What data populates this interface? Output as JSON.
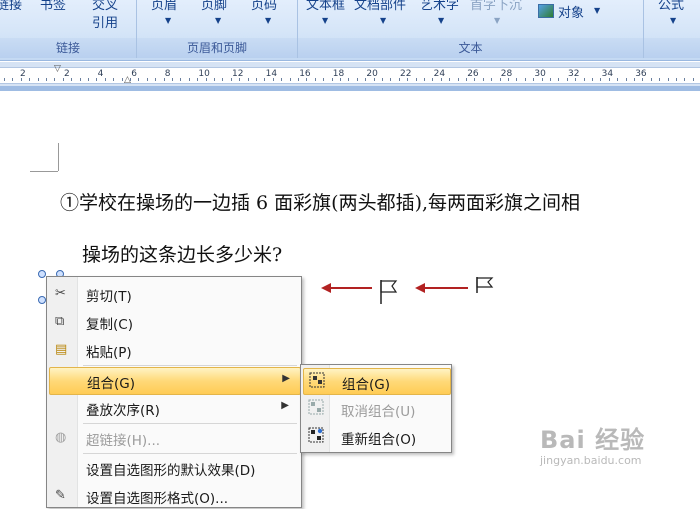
{
  "ribbon": {
    "insert_links_items": [
      "链接",
      "书签",
      "交叉",
      "引用"
    ],
    "header_footer_items": [
      "页眉",
      "页脚",
      "页码"
    ],
    "text_items": [
      "文本框",
      "文档部件",
      "艺术字",
      "首字下沉"
    ],
    "object_label": "对象",
    "formula_label": "公式",
    "groups": [
      "链接",
      "页眉和页脚",
      "文本"
    ]
  },
  "ruler": {
    "labels": [
      "2",
      "2",
      "4",
      "6",
      "8",
      "10",
      "12",
      "14",
      "16",
      "18",
      "20",
      "22",
      "24",
      "26",
      "28",
      "30",
      "32",
      "34",
      "36"
    ]
  },
  "document": {
    "line1": "①学校在操场的一边插 6 面彩旗(两头都插),每两面彩旗之间相",
    "line2": "操场的这条边长多少米?"
  },
  "context_menu": {
    "items": [
      {
        "label": "剪切(T)",
        "icon": "scissors-icon",
        "enabled": true
      },
      {
        "label": "复制(C)",
        "icon": "copy-icon",
        "enabled": true
      },
      {
        "label": "粘贴(P)",
        "icon": "paste-icon",
        "enabled": true
      },
      {
        "label": "组合(G)",
        "icon": "",
        "enabled": true,
        "submenu": true,
        "highlighted": true
      },
      {
        "label": "叠放次序(R)",
        "icon": "",
        "enabled": true,
        "submenu": true
      },
      {
        "label": "超链接(H)...",
        "icon": "hyperlink-icon",
        "enabled": false
      },
      {
        "label": "设置自选图形的默认效果(D)",
        "icon": "",
        "enabled": true
      },
      {
        "label": "设置自选图形格式(O)...",
        "icon": "format-shape-icon",
        "enabled": true
      }
    ]
  },
  "submenu": {
    "items": [
      {
        "label": "组合(G)",
        "icon": "group-icon",
        "enabled": true,
        "highlighted": true
      },
      {
        "label": "取消组合(U)",
        "icon": "ungroup-icon",
        "enabled": false
      },
      {
        "label": "重新组合(O)",
        "icon": "regroup-icon",
        "enabled": true
      }
    ]
  },
  "watermark": {
    "main": "Bai 经验",
    "sub": "jingyan.baidu.com"
  },
  "colors": {
    "accent_arrow": "#b22222",
    "menu_highlight": "#ffd978"
  }
}
